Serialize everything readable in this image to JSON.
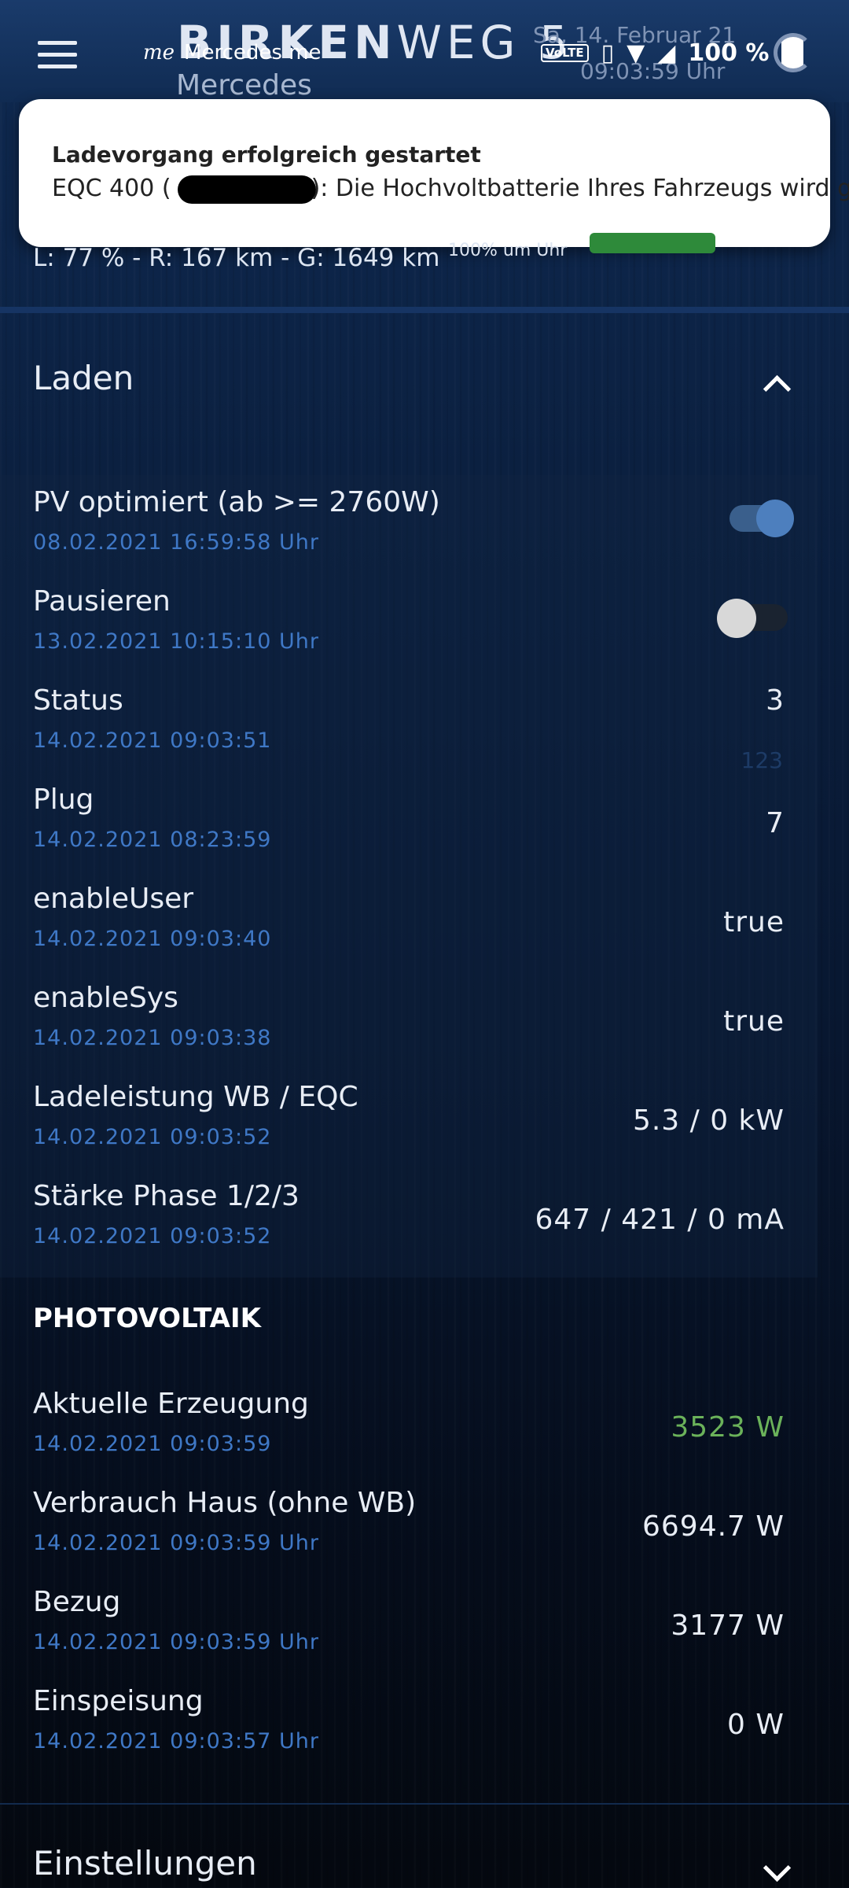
{
  "header": {
    "title_bold": "BIRKEN",
    "title_light": "WEG 5",
    "date": "Sa, 14. Februar 21",
    "time": "09:03:59  Uhr",
    "notification_app": "Mercedes me",
    "notification_logo": "me",
    "notification_sub": "Mercedes",
    "status": {
      "network": "VoLTE",
      "battery": "100 %"
    }
  },
  "toast": {
    "title": "Ladevorgang erfolgreich gestartet",
    "body_prefix": "EQC 400 (",
    "body_suffix": "): Die Hochvoltbatterie Ihres Fahrzeugs wird g.."
  },
  "summary": {
    "text": "L: 77 % - R: 167 km - G: 1649 km",
    "time": "100% um Uhr"
  },
  "sections": {
    "laden": "Laden",
    "photovoltaik": "PHOTOVOLTAIK",
    "einstellungen": "Einstellungen"
  },
  "laden": {
    "pv_optimized": {
      "label": "PV optimiert (ab >= 2760W)",
      "ts": "08.02.2021 16:59:58 Uhr",
      "on": true
    },
    "pause": {
      "label": "Pausieren",
      "ts": "13.02.2021 10:15:10 Uhr",
      "on": false
    },
    "status": {
      "label": "Status",
      "ts": "14.02.2021 09:03:51",
      "value": "3",
      "ghost": "123"
    },
    "plug": {
      "label": "Plug",
      "ts": "14.02.2021 08:23:59",
      "value": "7"
    },
    "enable_user": {
      "label": "enableUser",
      "ts": "14.02.2021 09:03:40",
      "value": "true"
    },
    "enable_sys": {
      "label": "enableSys",
      "ts": "14.02.2021 09:03:38",
      "value": "true"
    },
    "ladeleistung": {
      "label": "Ladeleistung WB / EQC",
      "ts": "14.02.2021 09:03:52",
      "value": "5.3 / 0 kW"
    },
    "phase": {
      "label": "Stärke Phase 1/2/3",
      "ts": "14.02.2021 09:03:52",
      "value": "647 / 421 / 0 mA"
    }
  },
  "pv": {
    "erzeugung": {
      "label": "Aktuelle Erzeugung",
      "ts": "14.02.2021 09:03:59",
      "value": "3523 W"
    },
    "verbrauch": {
      "label": "Verbrauch Haus (ohne WB)",
      "ts": "14.02.2021 09:03:59 Uhr",
      "value": "6694.7 W"
    },
    "bezug": {
      "label": "Bezug",
      "ts": "14.02.2021 09:03:59 Uhr",
      "value": "3177 W"
    },
    "einspeisung": {
      "label": "Einspeisung",
      "ts": "14.02.2021 09:03:57 Uhr",
      "value": "0 W"
    }
  },
  "colors": {
    "accent_blue": "#3f78c6",
    "green_value": "#6bb25a",
    "toggle_on": "#4d7fbe"
  }
}
